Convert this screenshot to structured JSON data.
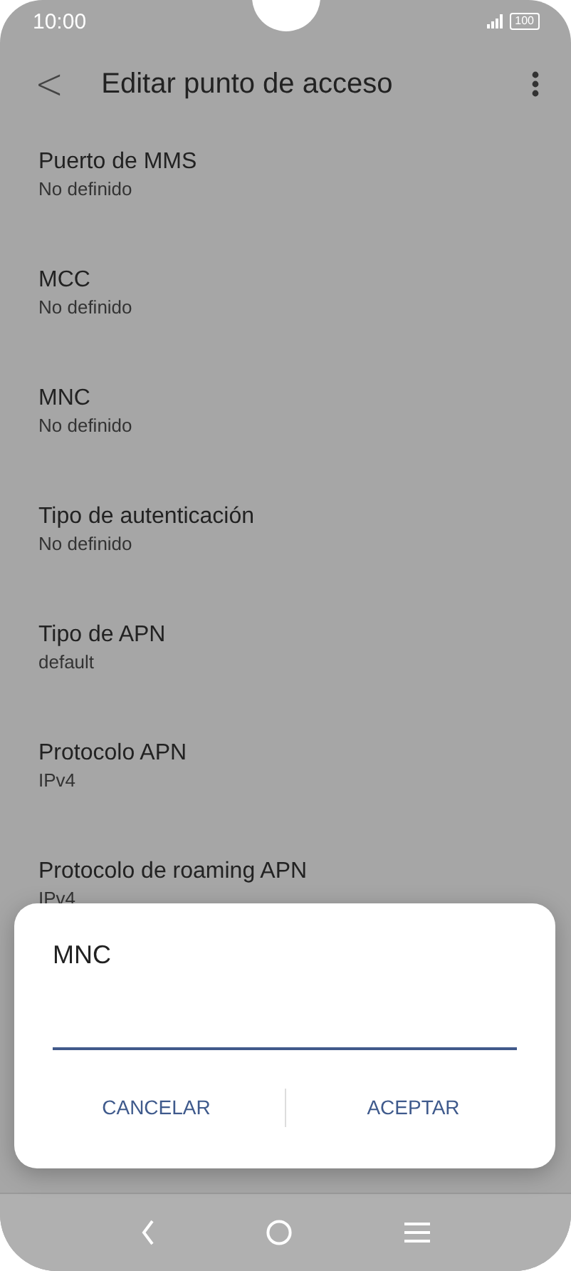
{
  "status_bar": {
    "time": "10:00",
    "battery": "100"
  },
  "header": {
    "back": "<",
    "title": "Editar punto de acceso"
  },
  "settings": [
    {
      "title": "Puerto de MMS",
      "value": "No definido"
    },
    {
      "title": "MCC",
      "value": "No definido"
    },
    {
      "title": "MNC",
      "value": "No definido"
    },
    {
      "title": "Tipo de autenticación",
      "value": "No definido"
    },
    {
      "title": "Tipo de APN",
      "value": "default"
    },
    {
      "title": "Protocolo APN",
      "value": "IPv4"
    },
    {
      "title": "Protocolo de roaming APN",
      "value": "IPv4"
    }
  ],
  "dialog": {
    "title": "MNC",
    "buttons": [
      "CANCELAR",
      "ACEPTAR"
    ]
  }
}
